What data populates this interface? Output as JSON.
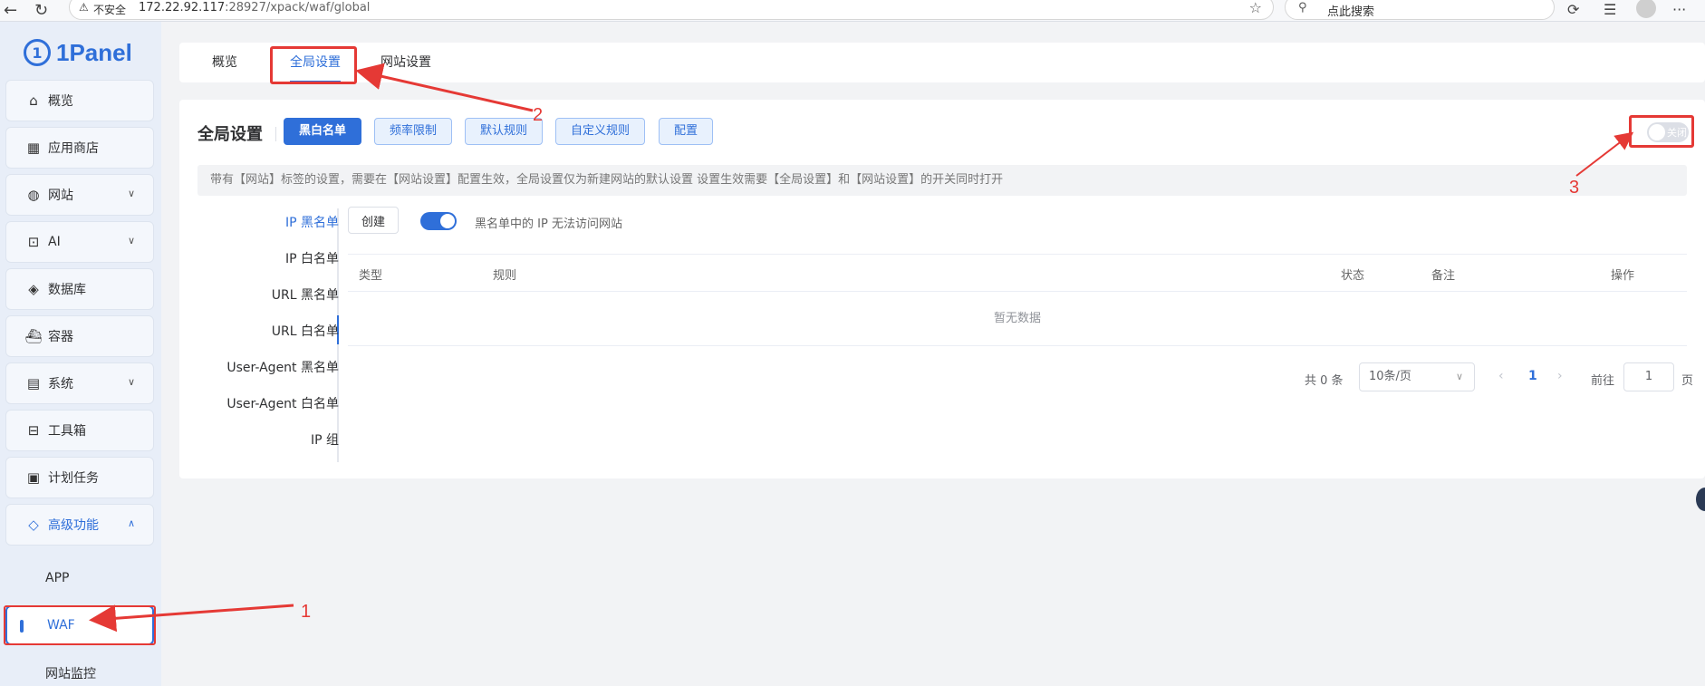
{
  "browser": {
    "security_label": "不安全",
    "url_host": "172.22.92.117",
    "url_path": ":28927/xpack/waf/global",
    "search_placeholder": "点此搜索"
  },
  "brand": {
    "name": "1Panel"
  },
  "sidebar": {
    "items": [
      {
        "label": "概览",
        "icon": "home-icon"
      },
      {
        "label": "应用商店",
        "icon": "grid-icon"
      },
      {
        "label": "网站",
        "icon": "globe-icon",
        "expandable": true
      },
      {
        "label": "AI",
        "icon": "robot-icon",
        "expandable": true
      },
      {
        "label": "数据库",
        "icon": "layers-icon"
      },
      {
        "label": "容器",
        "icon": "container-icon"
      },
      {
        "label": "系统",
        "icon": "server-icon",
        "expandable": true
      },
      {
        "label": "工具箱",
        "icon": "toolbox-icon"
      },
      {
        "label": "计划任务",
        "icon": "calendar-icon"
      },
      {
        "label": "高级功能",
        "icon": "diamond-icon",
        "expanded": true
      }
    ],
    "subitems": [
      {
        "label": "APP"
      },
      {
        "label": "WAF",
        "active": true
      },
      {
        "label": "网站监控"
      }
    ]
  },
  "tabs": [
    {
      "label": "概览"
    },
    {
      "label": "全局设置",
      "active": true
    },
    {
      "label": "网站设置"
    }
  ],
  "settings": {
    "title": "全局设置",
    "buttons": [
      "黑白名单",
      "频率限制",
      "默认规则",
      "自定义规则",
      "配置"
    ],
    "status_toggle_label": "关闭",
    "notice": "带有【网站】标签的设置，需要在【网站设置】配置生效，全局设置仅为新建网站的默认设置 设置生效需要【全局设置】和【网站设置】的开关同时打开"
  },
  "list_nav": [
    "IP 黑名单",
    "IP 白名单",
    "URL 黑名单",
    "URL 白名单",
    "User-Agent 黑名单",
    "User-Agent 白名单",
    "IP 组"
  ],
  "blacklist": {
    "create_label": "创建",
    "toggle_text": "黑名单中的 IP 无法访问网站",
    "columns": [
      "类型",
      "规则",
      "状态",
      "备注",
      "操作"
    ],
    "empty_text": "暂无数据"
  },
  "pagination": {
    "total": "共 0 条",
    "page_size": "10条/页",
    "current": "1",
    "goto_label": "前往",
    "goto_value": "1",
    "goto_unit": "页"
  },
  "annotations": [
    "1",
    "2",
    "3"
  ],
  "colors": {
    "accent": "#2f6fd9",
    "annotation": "#e53935"
  }
}
